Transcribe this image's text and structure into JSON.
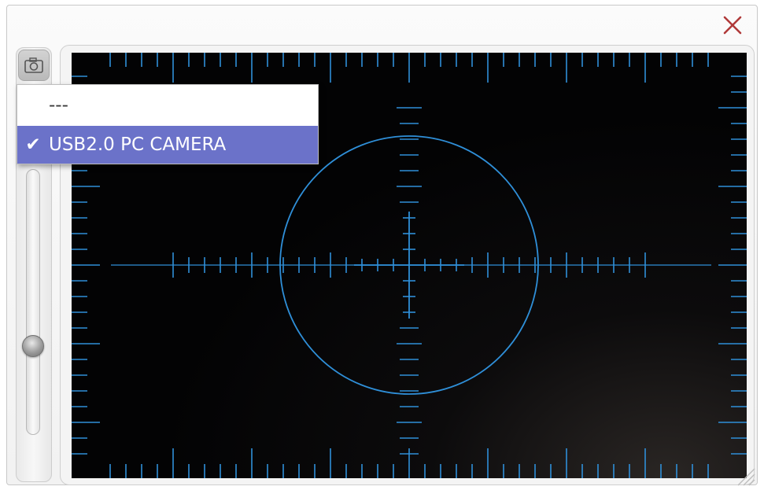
{
  "window": {
    "close_icon": "close-icon",
    "close_color": "#b03a3a"
  },
  "toolbar": {
    "camera_icon": "camera-icon"
  },
  "camera_menu": {
    "items": [
      {
        "label": "---",
        "checked": false
      },
      {
        "label": "USB2.0 PC CAMERA",
        "checked": true
      }
    ],
    "checkmark": "✔",
    "selected_color": "#6b72c9"
  },
  "zoom_slider": {
    "level": 0.34
  },
  "reticle": {
    "color": "#2f8fd8",
    "background": "#050506"
  }
}
